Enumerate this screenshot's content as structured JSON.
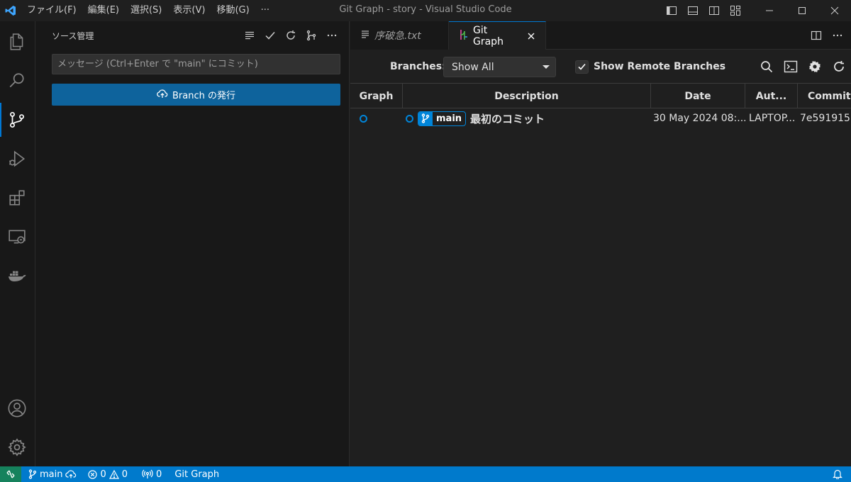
{
  "window": {
    "title": "Git Graph - story - Visual Studio Code",
    "menu": [
      "ファイル(F)",
      "編集(E)",
      "選択(S)",
      "表示(V)",
      "移動(G)",
      "···"
    ]
  },
  "sidebar": {
    "title": "ソース管理",
    "commit_placeholder": "メッセージ (Ctrl+Enter で \"main\" にコミット)",
    "publish_label": "Branch の発行"
  },
  "tabs": [
    {
      "label": "序破急.txt",
      "icon": "file-lines-icon"
    },
    {
      "label": "Git Graph",
      "icon": "git-graph-icon"
    }
  ],
  "gitgraph": {
    "branches_label": "Branches:",
    "branches_value": "Show All",
    "show_remote_label": "Show Remote Branches",
    "show_remote_checked": true,
    "columns": [
      "Graph",
      "Description",
      "Date",
      "Aut...",
      "Commit"
    ],
    "commits": [
      {
        "branch": "main",
        "message": "最初のコミット",
        "date": "30 May 2024 08:...",
        "author": "LAPTOP...",
        "hash": "7e591915"
      }
    ]
  },
  "statusbar": {
    "branch": "main",
    "errors": "0",
    "warnings": "0",
    "ports": "0",
    "extension": "Git Graph"
  },
  "colors": {
    "accent": "#0078d4",
    "statusbar": "#007acc",
    "button": "#0e639c",
    "graph_blue": "#0085d9",
    "vscode_logo": "#3ea6ff"
  }
}
